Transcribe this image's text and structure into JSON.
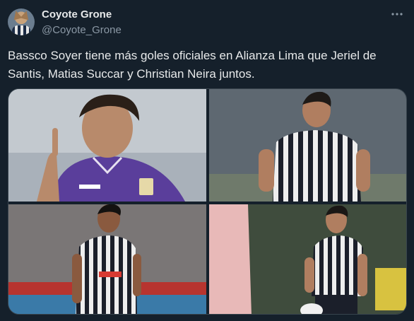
{
  "author": {
    "name": "Coyote Grone",
    "handle": "@Coyote_Grone"
  },
  "menu_icon": "more-horizontal-icon",
  "tweet": {
    "text": "Bassco Soyer tiene más goles oficiales en Alianza Lima que Jeriel de Santis, Matias Succar y Christian Neira juntos."
  },
  "media": {
    "photos": [
      {
        "subject": "player-purple-kit"
      },
      {
        "subject": "player-striped-kit"
      },
      {
        "subject": "player-striped-kit"
      },
      {
        "subject": "player-striped-kit-with-ball"
      }
    ]
  },
  "colors": {
    "background": "#15202b",
    "text": "#e7e9ea",
    "secondary_text": "#8b98a5"
  }
}
